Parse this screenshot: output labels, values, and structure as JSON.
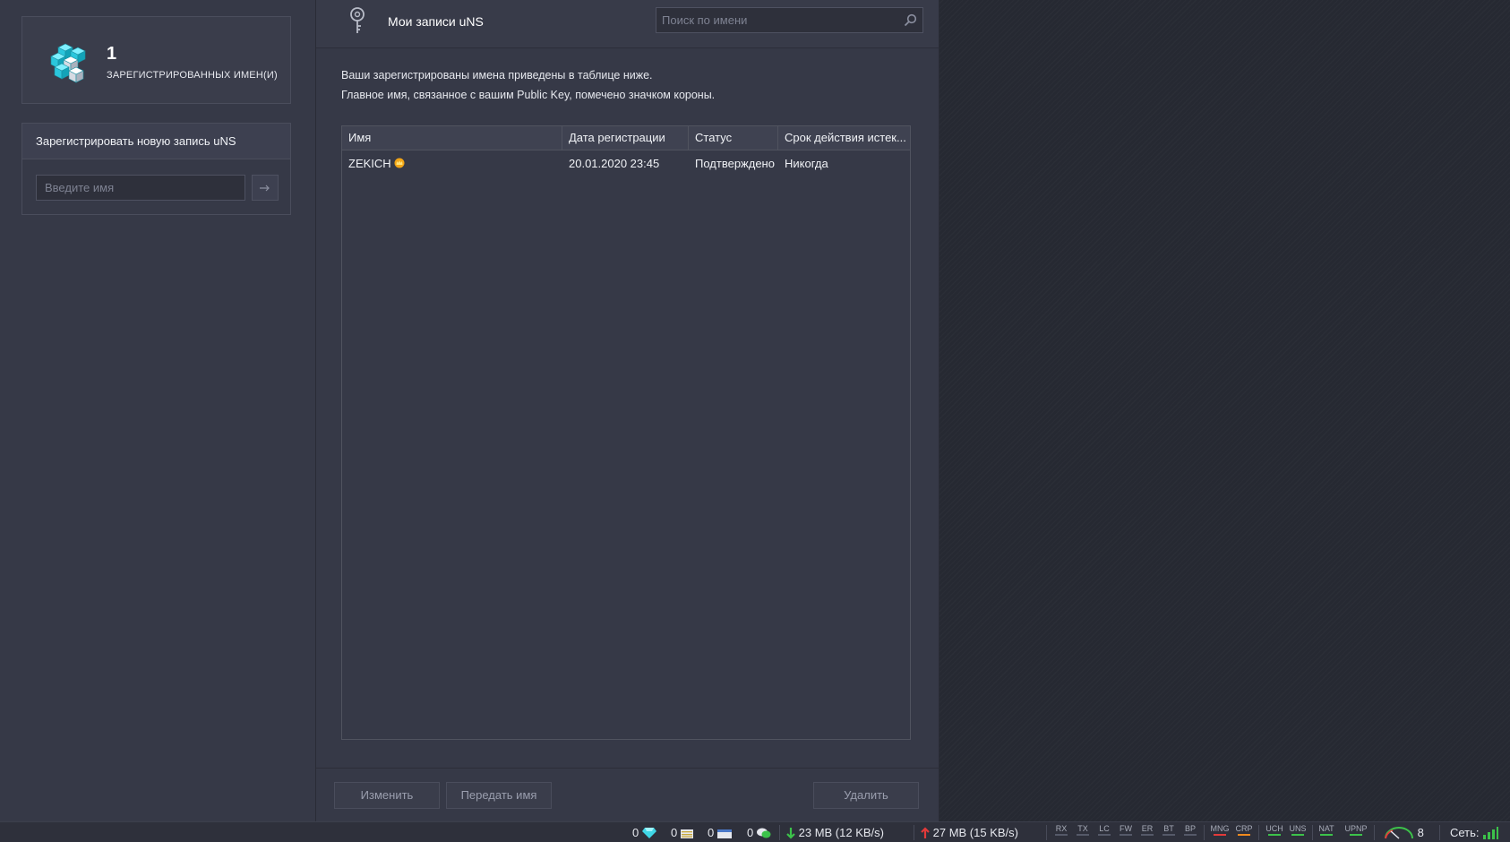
{
  "sidebar": {
    "stats": {
      "count": "1",
      "label": "ЗАРЕГИСТРИРОВАННЫХ ИМЕН(И)",
      "icon": "cubes-icon"
    },
    "register": {
      "title": "Зарегистрировать новую запись uNS",
      "input_placeholder": "Введите имя",
      "submit_icon": "arrow-right-icon"
    }
  },
  "header": {
    "title": "Мои записи uNS",
    "icon": "key-icon",
    "search_placeholder": "Поиск по имени"
  },
  "description": {
    "line1": "Ваши зарегистрированы имена приведены в таблице ниже.",
    "line2": "Главное имя, связанное с вашим Public Key, помечено значком короны."
  },
  "table": {
    "columns": [
      "Имя",
      "Дата регистрации",
      "Статус",
      "Срок действия истек..."
    ],
    "rows": [
      {
        "name": "ZEKICH",
        "primary": true,
        "date": "20.01.2020 23:45",
        "status": "Подтверждено",
        "expires": "Никогда"
      }
    ]
  },
  "footer": {
    "edit_label": "Изменить",
    "transfer_label": "Передать имя",
    "delete_label": "Удалить"
  },
  "statusbar": {
    "counters": [
      "0",
      "0",
      "0",
      "0"
    ],
    "download": "23 MB (12 KB/s)",
    "upload": "27 MB (15 KB/s)",
    "indicators": [
      "RX",
      "TX",
      "LC",
      "FW",
      "ER",
      "BT",
      "BP",
      "MNG",
      "CRP",
      "UCH",
      "UNS",
      "NAT",
      "UPNP"
    ],
    "peers": "8",
    "network_label": "Сеть:",
    "colors": {
      "green": "#3cc24a",
      "red": "#e23a3a",
      "orange": "#f08a1e",
      "cyan": "#3fd6e6"
    }
  }
}
